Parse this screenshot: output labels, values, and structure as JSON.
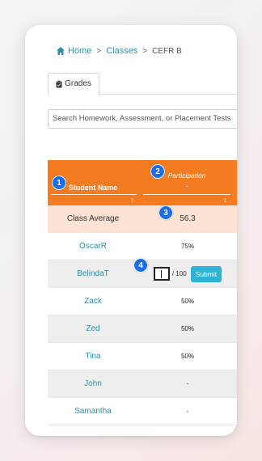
{
  "breadcrumb": {
    "home": "Home",
    "sep1": ">",
    "classes": "Classes",
    "sep2": ">",
    "current": "CEFR B"
  },
  "tabs": [
    {
      "label": "Grades",
      "icon": "clipboard-icon"
    }
  ],
  "search": {
    "placeholder": "Search Homework, Assessment, or Placement Tests"
  },
  "table": {
    "headers": {
      "name": "Student Name",
      "participation": "Participation",
      "participation_sub": "-",
      "sort": "↕"
    },
    "average": {
      "label": "Class Average",
      "value": "56.3"
    },
    "rows": [
      {
        "name": "OscarR",
        "value": "75%"
      },
      {
        "name": "BelindaT",
        "value": "",
        "max": "/ 100",
        "submit": "Submit"
      },
      {
        "name": "Zack",
        "value": "50%"
      },
      {
        "name": "Zed",
        "value": "50%"
      },
      {
        "name": "Tina",
        "value": "50%"
      },
      {
        "name": "John",
        "value": "-"
      },
      {
        "name": "Samantha",
        "value": "-"
      }
    ]
  },
  "badges": [
    "1",
    "2",
    "3",
    "4"
  ],
  "colors": {
    "header_orange": "#f47b20",
    "link_teal": "#2f8fa3",
    "badge_blue": "#1a6ee8",
    "submit_cyan": "#2bb4d4",
    "average_row": "#fce3d4"
  }
}
